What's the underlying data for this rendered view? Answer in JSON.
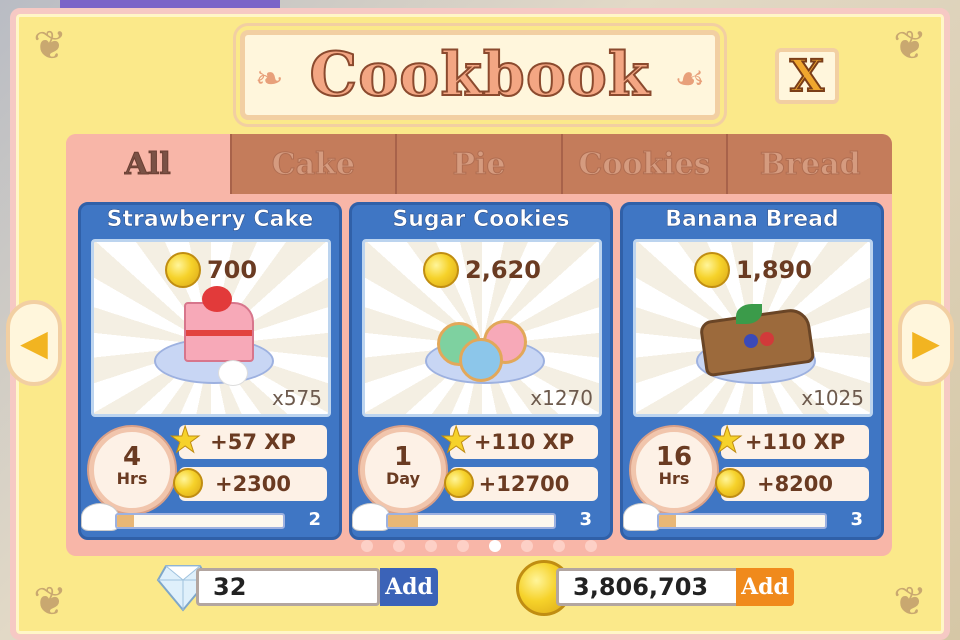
{
  "title": "Cookbook",
  "close_label": "X",
  "tabs": [
    {
      "label": "All",
      "active": true
    },
    {
      "label": "Cake",
      "active": false
    },
    {
      "label": "Pie",
      "active": false
    },
    {
      "label": "Cookies",
      "active": false
    },
    {
      "label": "Bread",
      "active": false
    }
  ],
  "recipes": [
    {
      "name": "Strawberry Cake",
      "price": "700",
      "count": "x575",
      "time_num": "4",
      "time_unit": "Hrs",
      "xp": "+57 XP",
      "coins": "+2300",
      "level": "2",
      "progress": 0.1
    },
    {
      "name": "Sugar Cookies",
      "price": "2,620",
      "count": "x1270",
      "time_num": "1",
      "time_unit": "Day",
      "xp": "+110 XP",
      "coins": "+12700",
      "level": "3",
      "progress": 0.18
    },
    {
      "name": "Banana Bread",
      "price": "1,890",
      "count": "x1025",
      "time_num": "16",
      "time_unit": "Hrs",
      "xp": "+110 XP",
      "coins": "+8200",
      "level": "3",
      "progress": 0.1
    }
  ],
  "pager": {
    "total": 8,
    "active_index": 4
  },
  "currency": {
    "gems": "32",
    "coins": "3,806,703",
    "add_label": "Add"
  },
  "colors": {
    "board": "#fbe98a",
    "card": "#3f76c4",
    "tab_inactive": "#c47c5b",
    "panel": "#f8b6a8",
    "gem_add": "#3b63b8",
    "coin_add": "#f08a1c"
  },
  "icons": [
    "gold-coin-icon",
    "xp-star-icon",
    "chef-hat-icon",
    "diamond-icon",
    "left-arrow-icon",
    "right-arrow-icon",
    "close-icon"
  ]
}
